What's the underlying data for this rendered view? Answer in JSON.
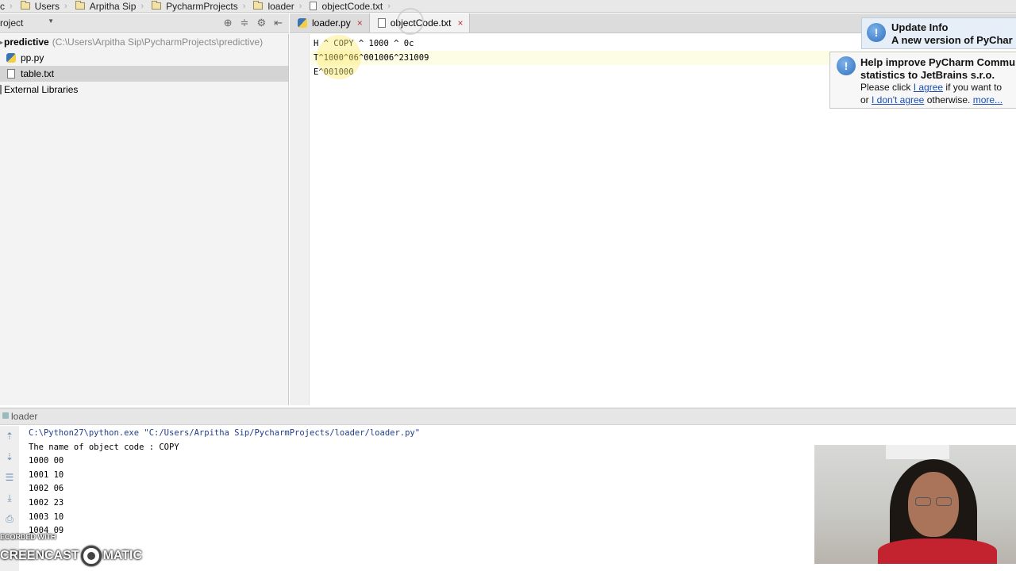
{
  "breadcrumbs": {
    "lead": "c",
    "items": [
      "Users",
      "Arpitha Sip",
      "PycharmProjects",
      "loader"
    ],
    "file": "objectCode.txt"
  },
  "project_panel": {
    "selector": "roject",
    "tree": [
      {
        "name": "predictive",
        "path": "(C:\\Users\\Arpitha Sip\\PycharmProjects\\predictive)",
        "kind": "folder"
      },
      {
        "name": "pp.py",
        "kind": "py"
      },
      {
        "name": "table.txt",
        "kind": "txt",
        "selected": true
      },
      {
        "name": "External Libraries",
        "kind": "lib"
      }
    ]
  },
  "tabs": [
    {
      "label": "loader.py",
      "close": "×"
    },
    {
      "label": "objectCode.txt",
      "close": "×",
      "active": true
    }
  ],
  "editor": {
    "lines": [
      "H ^ COPY ^ 1000 ^ 0c",
      "T^1000^06^001006^231009",
      "E^001000"
    ]
  },
  "notifications": [
    {
      "title": "Update Info",
      "text": "A new version of PyChar"
    },
    {
      "title_line1": "Help improve PyCharm Commu",
      "title_line2": "statistics to JetBrains s.r.o.",
      "line3_pre": "Please click ",
      "line3_link": "I agree",
      "line3_post": " if you want to",
      "line4_pre": "or ",
      "line4_link": "I don't agree",
      "line4_post": " otherwise. ",
      "line4_link2": "more..."
    }
  ],
  "run_panel": {
    "title": "loader",
    "output": [
      "C:\\Python27\\python.exe \"C:/Users/Arpitha Sip/PycharmProjects/loader/loader.py\"",
      "The name of object code : COPY",
      "1000 00",
      "1001 10",
      "1002 06",
      "1002 23",
      "1003 10",
      "1004 09"
    ]
  },
  "watermark": {
    "small": "ECORDED WITH",
    "big_left": "CREENCAST",
    "big_right": "MATIC"
  },
  "colors": {
    "accent_link": "#1a4fb5",
    "highlight_line": "#fdfce4",
    "console_command": "#1e3e8c"
  }
}
